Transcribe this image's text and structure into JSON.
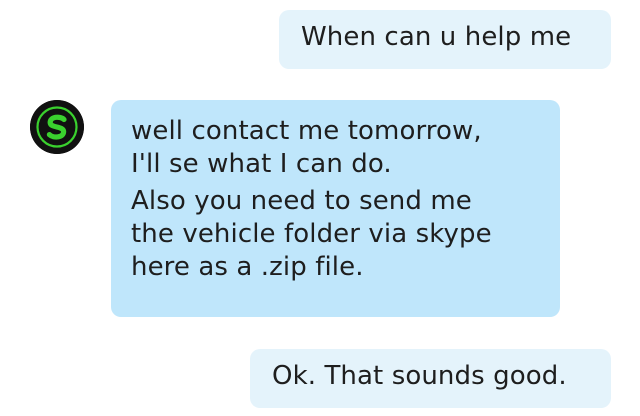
{
  "conversation": {
    "messages": [
      {
        "sender": "me",
        "lines": [
          "When can u help me"
        ]
      },
      {
        "sender": "contact",
        "lines": [
          "well contact me tomorrow,",
          "I'll se what I can do.",
          "Also you need to send me",
          "the vehicle folder via skype",
          "here as a .zip file."
        ]
      },
      {
        "sender": "me",
        "lines": [
          "Ok. That sounds good."
        ]
      }
    ]
  },
  "contact": {
    "avatar_icon": "green-s-logo-icon",
    "avatar_colors": {
      "background": "#111111",
      "logo": "#3ad12e"
    }
  },
  "colors": {
    "sent_bubble": "#e4f3fb",
    "received_bubble": "#bfe6fb",
    "text": "#1e1e1e",
    "background": "#ffffff"
  }
}
